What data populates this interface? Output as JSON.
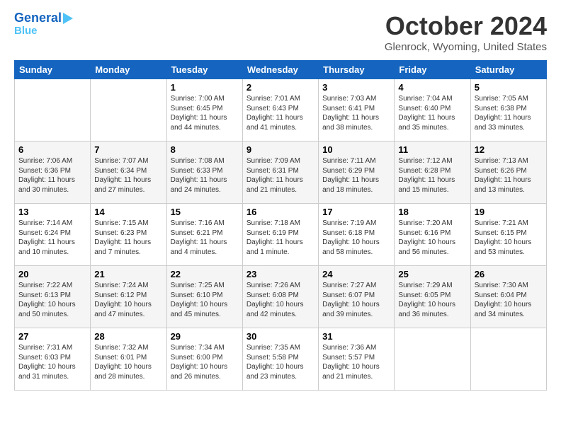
{
  "logo": {
    "line1": "General",
    "line2": "Blue"
  },
  "title": "October 2024",
  "location": "Glenrock, Wyoming, United States",
  "days_header": [
    "Sunday",
    "Monday",
    "Tuesday",
    "Wednesday",
    "Thursday",
    "Friday",
    "Saturday"
  ],
  "weeks": [
    [
      {
        "day": "",
        "info": ""
      },
      {
        "day": "",
        "info": ""
      },
      {
        "day": "1",
        "info": "Sunrise: 7:00 AM\nSunset: 6:45 PM\nDaylight: 11 hours and 44 minutes."
      },
      {
        "day": "2",
        "info": "Sunrise: 7:01 AM\nSunset: 6:43 PM\nDaylight: 11 hours and 41 minutes."
      },
      {
        "day": "3",
        "info": "Sunrise: 7:03 AM\nSunset: 6:41 PM\nDaylight: 11 hours and 38 minutes."
      },
      {
        "day": "4",
        "info": "Sunrise: 7:04 AM\nSunset: 6:40 PM\nDaylight: 11 hours and 35 minutes."
      },
      {
        "day": "5",
        "info": "Sunrise: 7:05 AM\nSunset: 6:38 PM\nDaylight: 11 hours and 33 minutes."
      }
    ],
    [
      {
        "day": "6",
        "info": "Sunrise: 7:06 AM\nSunset: 6:36 PM\nDaylight: 11 hours and 30 minutes."
      },
      {
        "day": "7",
        "info": "Sunrise: 7:07 AM\nSunset: 6:34 PM\nDaylight: 11 hours and 27 minutes."
      },
      {
        "day": "8",
        "info": "Sunrise: 7:08 AM\nSunset: 6:33 PM\nDaylight: 11 hours and 24 minutes."
      },
      {
        "day": "9",
        "info": "Sunrise: 7:09 AM\nSunset: 6:31 PM\nDaylight: 11 hours and 21 minutes."
      },
      {
        "day": "10",
        "info": "Sunrise: 7:11 AM\nSunset: 6:29 PM\nDaylight: 11 hours and 18 minutes."
      },
      {
        "day": "11",
        "info": "Sunrise: 7:12 AM\nSunset: 6:28 PM\nDaylight: 11 hours and 15 minutes."
      },
      {
        "day": "12",
        "info": "Sunrise: 7:13 AM\nSunset: 6:26 PM\nDaylight: 11 hours and 13 minutes."
      }
    ],
    [
      {
        "day": "13",
        "info": "Sunrise: 7:14 AM\nSunset: 6:24 PM\nDaylight: 11 hours and 10 minutes."
      },
      {
        "day": "14",
        "info": "Sunrise: 7:15 AM\nSunset: 6:23 PM\nDaylight: 11 hours and 7 minutes."
      },
      {
        "day": "15",
        "info": "Sunrise: 7:16 AM\nSunset: 6:21 PM\nDaylight: 11 hours and 4 minutes."
      },
      {
        "day": "16",
        "info": "Sunrise: 7:18 AM\nSunset: 6:19 PM\nDaylight: 11 hours and 1 minute."
      },
      {
        "day": "17",
        "info": "Sunrise: 7:19 AM\nSunset: 6:18 PM\nDaylight: 10 hours and 58 minutes."
      },
      {
        "day": "18",
        "info": "Sunrise: 7:20 AM\nSunset: 6:16 PM\nDaylight: 10 hours and 56 minutes."
      },
      {
        "day": "19",
        "info": "Sunrise: 7:21 AM\nSunset: 6:15 PM\nDaylight: 10 hours and 53 minutes."
      }
    ],
    [
      {
        "day": "20",
        "info": "Sunrise: 7:22 AM\nSunset: 6:13 PM\nDaylight: 10 hours and 50 minutes."
      },
      {
        "day": "21",
        "info": "Sunrise: 7:24 AM\nSunset: 6:12 PM\nDaylight: 10 hours and 47 minutes."
      },
      {
        "day": "22",
        "info": "Sunrise: 7:25 AM\nSunset: 6:10 PM\nDaylight: 10 hours and 45 minutes."
      },
      {
        "day": "23",
        "info": "Sunrise: 7:26 AM\nSunset: 6:08 PM\nDaylight: 10 hours and 42 minutes."
      },
      {
        "day": "24",
        "info": "Sunrise: 7:27 AM\nSunset: 6:07 PM\nDaylight: 10 hours and 39 minutes."
      },
      {
        "day": "25",
        "info": "Sunrise: 7:29 AM\nSunset: 6:05 PM\nDaylight: 10 hours and 36 minutes."
      },
      {
        "day": "26",
        "info": "Sunrise: 7:30 AM\nSunset: 6:04 PM\nDaylight: 10 hours and 34 minutes."
      }
    ],
    [
      {
        "day": "27",
        "info": "Sunrise: 7:31 AM\nSunset: 6:03 PM\nDaylight: 10 hours and 31 minutes."
      },
      {
        "day": "28",
        "info": "Sunrise: 7:32 AM\nSunset: 6:01 PM\nDaylight: 10 hours and 28 minutes."
      },
      {
        "day": "29",
        "info": "Sunrise: 7:34 AM\nSunset: 6:00 PM\nDaylight: 10 hours and 26 minutes."
      },
      {
        "day": "30",
        "info": "Sunrise: 7:35 AM\nSunset: 5:58 PM\nDaylight: 10 hours and 23 minutes."
      },
      {
        "day": "31",
        "info": "Sunrise: 7:36 AM\nSunset: 5:57 PM\nDaylight: 10 hours and 21 minutes."
      },
      {
        "day": "",
        "info": ""
      },
      {
        "day": "",
        "info": ""
      }
    ]
  ]
}
